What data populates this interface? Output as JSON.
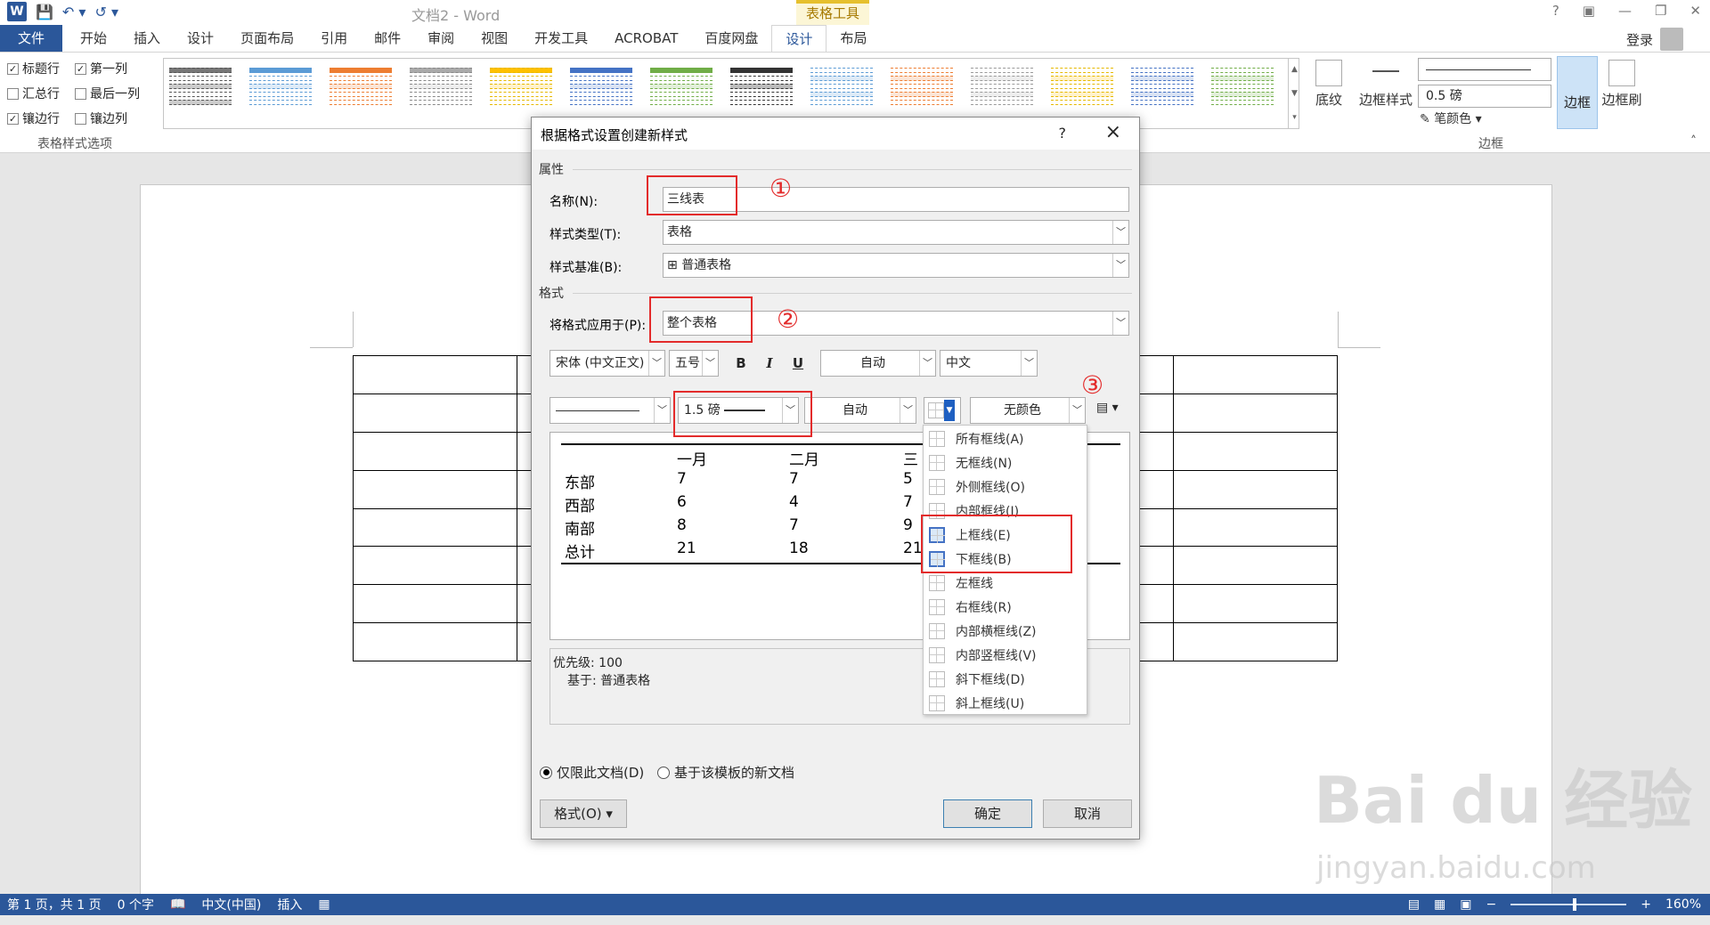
{
  "window": {
    "doc_title": "文档2 - Word",
    "tools_title": "表格工具",
    "help": "?",
    "login": "登录"
  },
  "tabs": [
    "文件",
    "开始",
    "插入",
    "设计",
    "页面布局",
    "引用",
    "邮件",
    "审阅",
    "视图",
    "开发工具",
    "ACROBAT",
    "百度网盘",
    "设计",
    "布局"
  ],
  "ribbon": {
    "options": [
      {
        "label": "标题行",
        "checked": true
      },
      {
        "label": "第一列",
        "checked": true
      },
      {
        "label": "汇总行",
        "checked": false
      },
      {
        "label": "最后一列",
        "checked": false
      },
      {
        "label": "镶边行",
        "checked": true
      },
      {
        "label": "镶边列",
        "checked": false
      }
    ],
    "options_group": "表格样式选项",
    "shading": "底纹",
    "border_style": "边框样式",
    "line_weight": "0.5 磅",
    "pen_color": "笔颜色",
    "borders": "边框",
    "border_painter": "边框刷",
    "border_group": "边框"
  },
  "dialog": {
    "title": "根据格式设置创建新样式",
    "help": "?",
    "close": "×",
    "section_props": "属性",
    "name_label": "名称(N):",
    "name_value": "三线表",
    "type_label": "样式类型(T):",
    "type_value": "表格",
    "base_label": "样式基准(B):",
    "base_value": "普通表格",
    "section_format": "格式",
    "apply_label": "将格式应用于(P):",
    "apply_value": "整个表格",
    "font": "宋体 (中文正文)",
    "size": "五号",
    "bold": "B",
    "italic": "I",
    "underline": "U",
    "color_auto": "自动",
    "lang": "中文",
    "line_weight": "1.5 磅",
    "line_color": "自动",
    "shading": "无颜色",
    "preview": {
      "headers": [
        "一月",
        "二月",
        "三"
      ],
      "rows": [
        {
          "label": "东部",
          "v1": "7",
          "v2": "7",
          "v3": "5"
        },
        {
          "label": "西部",
          "v1": "6",
          "v2": "4",
          "v3": "7"
        },
        {
          "label": "南部",
          "v1": "8",
          "v2": "7",
          "v3": "9"
        },
        {
          "label": "总计",
          "v1": "21",
          "v2": "18",
          "v3": "21"
        }
      ]
    },
    "priority": "优先级: 100",
    "based_on": "基于: 普通表格",
    "radio_doc": "仅限此文档(D)",
    "radio_template": "基于该模板的新文档",
    "format_btn": "格式(O) ▾",
    "ok": "确定",
    "cancel": "取消"
  },
  "border_menu": [
    {
      "label": "所有框线(A)",
      "selected": false
    },
    {
      "label": "无框线(N)",
      "selected": false
    },
    {
      "label": "外侧框线(O)",
      "selected": false
    },
    {
      "label": "内部框线(I)",
      "selected": false
    },
    {
      "label": "上框线(E)",
      "selected": true
    },
    {
      "label": "下框线(B)",
      "selected": true
    },
    {
      "label": "左框线",
      "selected": false
    },
    {
      "label": "右框线(R)",
      "selected": false
    },
    {
      "label": "内部横框线(Z)",
      "selected": false
    },
    {
      "label": "内部竖框线(V)",
      "selected": false
    },
    {
      "label": "斜下框线(D)",
      "selected": false
    },
    {
      "label": "斜上框线(U)",
      "selected": false
    }
  ],
  "annotations": [
    "①",
    "②",
    "③"
  ],
  "status": {
    "page": "第 1 页，共 1 页",
    "words": "0 个字",
    "lang": "中文(中国)",
    "mode": "插入",
    "zoom": "160%"
  },
  "watermark": {
    "main": "Bai du 经验",
    "sub": "jingyan.baidu.com"
  }
}
